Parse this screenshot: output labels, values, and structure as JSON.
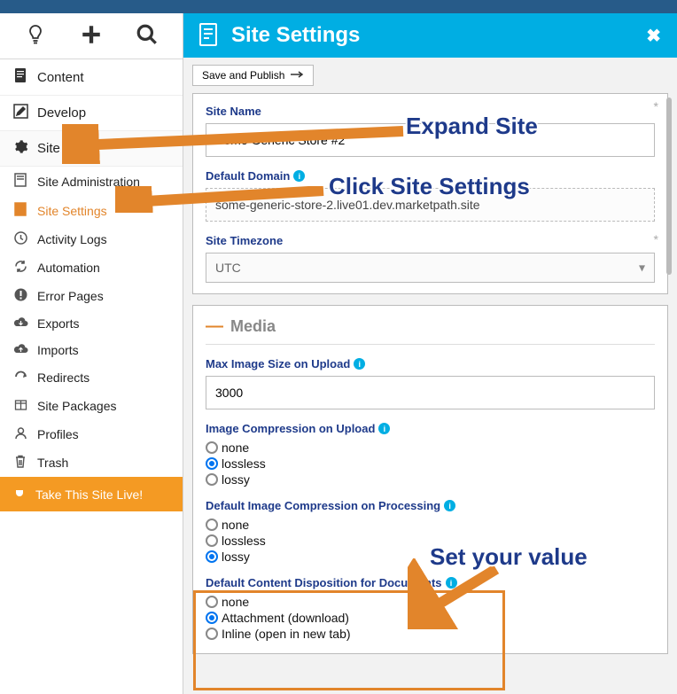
{
  "panel": {
    "title": "Site Settings"
  },
  "toolbar": {
    "save_label": "Save and Publish"
  },
  "nav": {
    "content": "Content",
    "develop": "Develop",
    "site": "Site",
    "subitems": {
      "site_admin": "Site Administration",
      "site_settings": "Site Settings",
      "activity_logs": "Activity Logs",
      "automation": "Automation",
      "error_pages": "Error Pages",
      "exports": "Exports",
      "imports": "Imports",
      "redirects": "Redirects",
      "site_packages": "Site Packages",
      "profiles": "Profiles",
      "trash": "Trash"
    },
    "live": "Take This Site Live!"
  },
  "form": {
    "site_name": {
      "label": "Site Name",
      "value": "Some Generic Store #2"
    },
    "default_domain": {
      "label": "Default Domain",
      "value": "some-generic-store-2.live01.dev.marketpath.site"
    },
    "site_timezone": {
      "label": "Site Timezone",
      "value": "UTC"
    },
    "media": {
      "section": "Media",
      "max_image_size": {
        "label": "Max Image Size on Upload",
        "value": "3000"
      },
      "image_compression_upload": {
        "label": "Image Compression on Upload",
        "options": {
          "none": "none",
          "lossless": "lossless",
          "lossy": "lossy"
        },
        "selected": "lossless"
      },
      "image_compression_processing": {
        "label": "Default Image Compression on Processing",
        "options": {
          "none": "none",
          "lossless": "lossless",
          "lossy": "lossy"
        },
        "selected": "lossy"
      },
      "content_disposition": {
        "label": "Default Content Disposition for Documents",
        "options": {
          "none": "none",
          "attachment": "Attachment (download)",
          "inline": "Inline (open in new tab)"
        },
        "selected": "attachment"
      }
    }
  },
  "annotations": {
    "expand": "Expand Site",
    "click_settings": "Click Site Settings",
    "set_value": "Set your value"
  }
}
